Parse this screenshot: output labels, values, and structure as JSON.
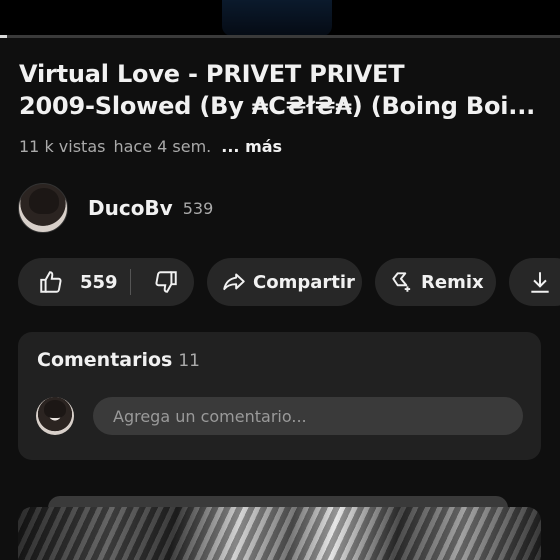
{
  "video": {
    "title_line1": "Virtual Love - PRIVET PRIVET",
    "title_line2": "2009-Slowed (By ₳C₴ł₴₳) (Boing Boi...",
    "views": "11 k vistas",
    "published": "hace 4 sem.",
    "more_label": "... más",
    "progress_fraction": 0.012
  },
  "channel": {
    "name": "DucoBv",
    "subscribers": "539"
  },
  "actions": {
    "like_count": "559",
    "share_label": "Compartir",
    "remix_label": "Remix"
  },
  "comments": {
    "heading": "Comentarios",
    "count": "11",
    "input_placeholder": "Agrega un comentario..."
  },
  "icons": {
    "like": "thumbs-up-icon",
    "dislike": "thumbs-down-icon",
    "share": "share-arrow-icon",
    "remix": "remix-icon",
    "download": "download-icon"
  },
  "colors": {
    "background": "#0f0f0f",
    "pill": "#272727",
    "card": "#212121",
    "text": "#f1f1f1",
    "secondary_text": "#aaaaaa"
  }
}
